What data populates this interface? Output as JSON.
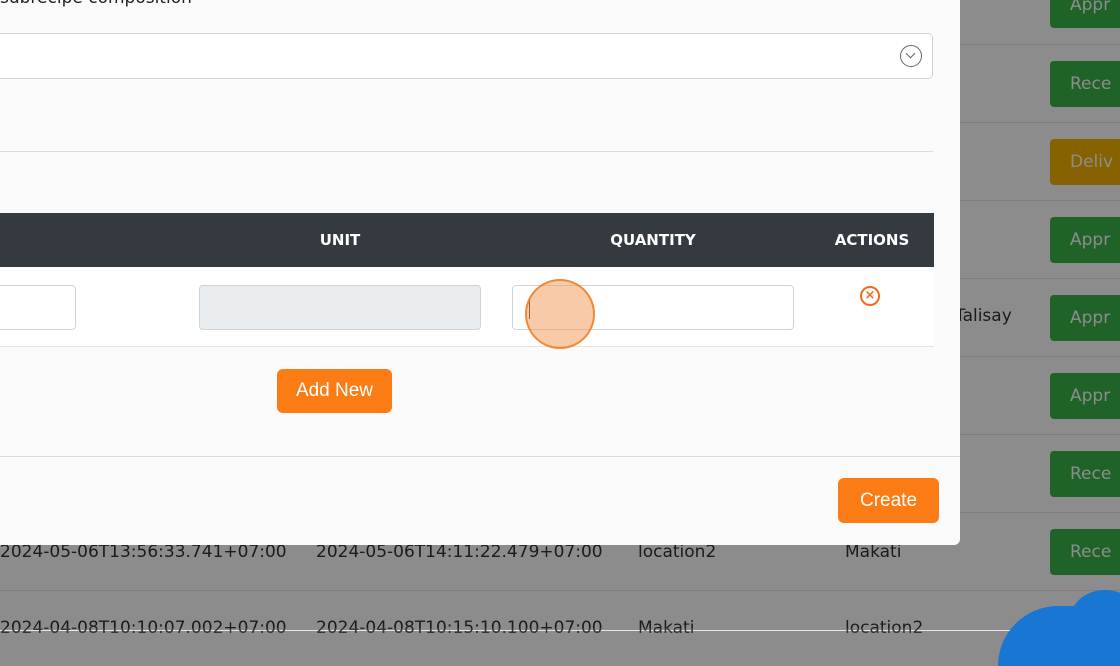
{
  "background_table": {
    "rows": [
      {
        "badge": "Appr",
        "badge_color": "#3ab54a"
      },
      {
        "badge": "Rece",
        "badge_color": "#3ab54a"
      },
      {
        "badge": "Deliv",
        "badge_color": "#f4b400"
      },
      {
        "badge": "Appr",
        "badge_color": "#3ab54a"
      },
      {
        "badge": "Appr",
        "badge_color": "#3ab54a",
        "location": "Talisay"
      },
      {
        "badge": "Appr",
        "badge_color": "#3ab54a"
      },
      {
        "badge": "Rece",
        "badge_color": "#3ab54a"
      },
      {
        "badge": "Rece",
        "badge_color": "#3ab54a",
        "created": "2024-05-06T13:56:33.741+07:00",
        "updated": "2024-05-06T14:11:22.479+07:00",
        "from": "location2",
        "to": "Makati"
      },
      {
        "created": "2024-04-08T10:10:07.002+07:00",
        "updated": "2024-04-08T10:15:10.100+07:00",
        "from": "Makati",
        "to": "location2"
      }
    ]
  },
  "modal": {
    "section_title": "subrecipe composition",
    "select": {
      "value": "",
      "icon": "chevron-down-circle-icon"
    },
    "table": {
      "headers": {
        "unit": "UNIT",
        "quantity": "QUANTITY",
        "actions": "ACTIONS"
      },
      "row": {
        "item_value": "",
        "unit_value": "",
        "quantity_value": "",
        "remove_icon": "remove-circle-icon"
      }
    },
    "add_new_label": "Add New",
    "create_label": "Create"
  },
  "colors": {
    "accent": "#fb7b14",
    "header_bg": "#343a40",
    "success": "#3ab54a",
    "warning": "#f4b400"
  }
}
